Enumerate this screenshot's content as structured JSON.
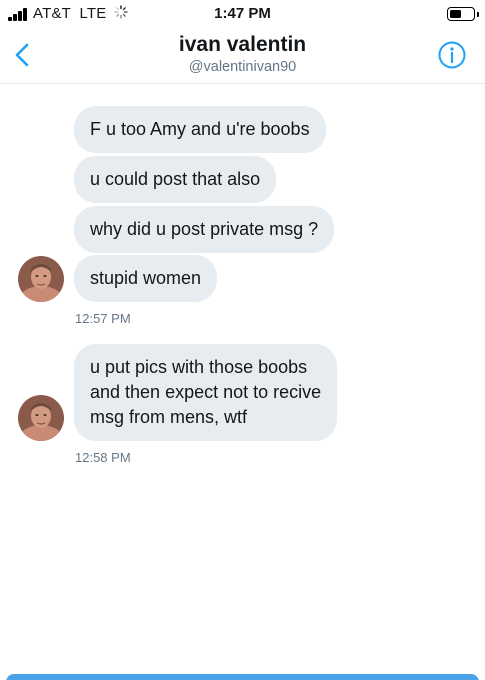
{
  "status_bar": {
    "carrier": "AT&T  LTE",
    "time": "1:47 PM"
  },
  "header": {
    "name": "ivan valentin",
    "handle": "@valentinivan90"
  },
  "conversation": {
    "groups": [
      {
        "messages": [
          "F u too Amy and u're boobs",
          "u could post that also",
          "why did u post private msg ?",
          "stupid women"
        ],
        "time": "12:57 PM"
      },
      {
        "messages": [
          "u put pics with those boobs",
          "and then expect not to recive",
          "msg from mens, wtf"
        ],
        "time": "12:58 PM"
      }
    ]
  },
  "colors": {
    "accent": "#1da1f2",
    "bubble": "#e6ecf0",
    "secondary_text": "#657786"
  }
}
